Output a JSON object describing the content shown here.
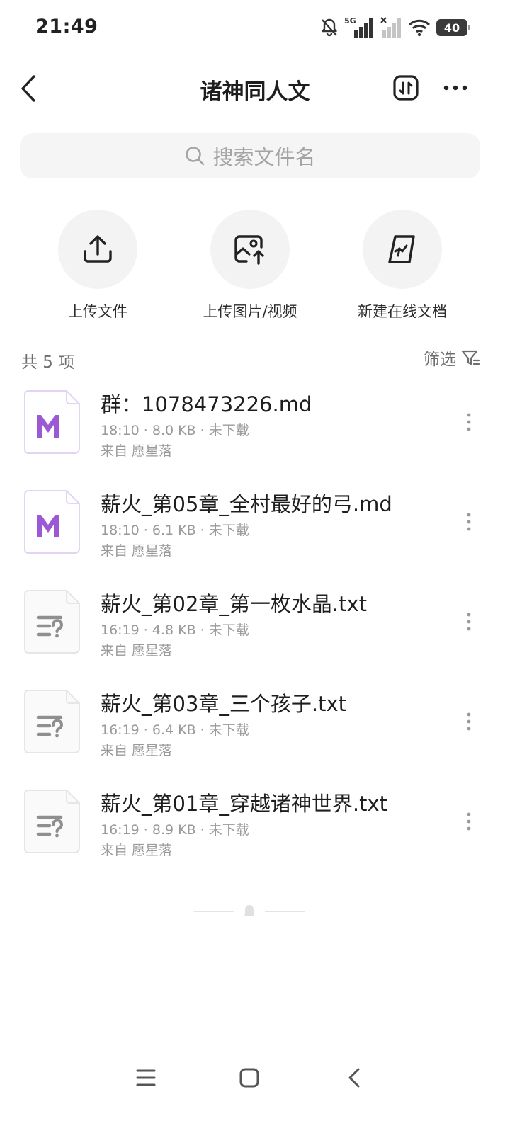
{
  "status_bar": {
    "time": "21:49",
    "network_label": "5G",
    "battery_level": "40"
  },
  "header": {
    "title": "诸神同人文",
    "back_icon": "chevron-left-icon",
    "sort_icon": "sort-icon",
    "more_icon": "more-horizontal-icon"
  },
  "search": {
    "placeholder": "搜索文件名",
    "icon": "search-icon"
  },
  "quick_actions": [
    {
      "label": "上传文件",
      "icon": "upload-icon"
    },
    {
      "label": "上传图片/视频",
      "icon": "image-upload-icon"
    },
    {
      "label": "新建在线文档",
      "icon": "new-doc-icon"
    }
  ],
  "list": {
    "count_label": "共 5 项",
    "filter_label": "筛选",
    "files": [
      {
        "name": "群：1078473226.md",
        "meta": "18:10 · 8.0 KB · 未下载",
        "source": "来自 愿星落",
        "type": "md"
      },
      {
        "name": "薪火_第05章_全村最好的弓.md",
        "meta": "18:10 · 6.1 KB · 未下载",
        "source": "来自 愿星落",
        "type": "md"
      },
      {
        "name": "薪火_第02章_第一枚水晶.txt",
        "meta": "16:19 · 4.8 KB · 未下载",
        "source": "来自 愿星落",
        "type": "txt"
      },
      {
        "name": "薪火_第03章_三个孩子.txt",
        "meta": "16:19 · 6.4 KB · 未下载",
        "source": "来自 愿星落",
        "type": "txt"
      },
      {
        "name": "薪火_第01章_穿越诸神世界.txt",
        "meta": "16:19 · 8.9 KB · 未下载",
        "source": "来自 愿星落",
        "type": "txt"
      }
    ]
  },
  "colors": {
    "md_accent": "#9b59d6",
    "md_border": "#e2d4f3",
    "txt_border": "#e6e6e6",
    "txt_glyph": "#8f8f8f",
    "muted_text": "#9a9a9a"
  }
}
